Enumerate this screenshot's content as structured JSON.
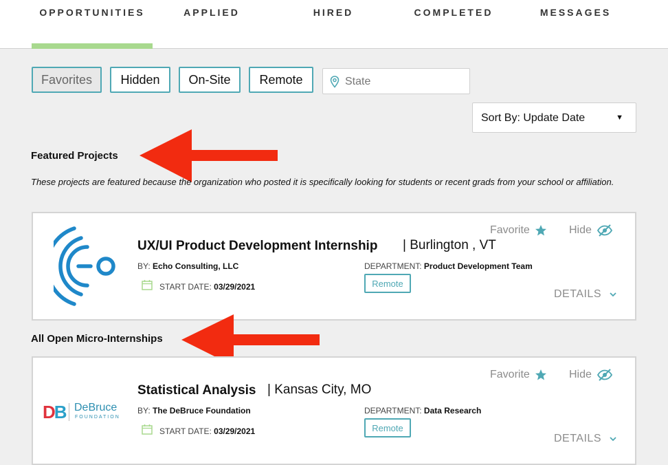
{
  "nav": {
    "tabs": [
      {
        "label": "OPPORTUNITIES",
        "active": true
      },
      {
        "label": "APPLIED"
      },
      {
        "label": "HIRED"
      },
      {
        "label": "COMPLETED"
      },
      {
        "label": "MESSAGES"
      }
    ]
  },
  "filters": {
    "favorites": "Favorites",
    "hidden": "Hidden",
    "onsite": "On-Site",
    "remote": "Remote",
    "state_placeholder": "State",
    "sort": "Sort By: Update Date"
  },
  "featured": {
    "title": "Featured Projects",
    "note": "These projects are featured because the organization who posted it is specifically looking for students or recent grads from your school or affiliation."
  },
  "all_open": {
    "title": "All Open Micro-Internships"
  },
  "cards": [
    {
      "title": "UX/UI Product Development Internship",
      "location": "| Burlington , VT",
      "by_label": "BY:",
      "org": "Echo Consulting, LLC",
      "dept_label": "DEPARTMENT:",
      "dept": "Product Development Team",
      "start_label": "START DATE:",
      "start": "03/29/2021",
      "tag": "Remote",
      "favorite": "Favorite",
      "hide": "Hide",
      "details": "DETAILS"
    },
    {
      "title": "Statistical Analysis",
      "location": "| Kansas City, MO",
      "by_label": "BY:",
      "org": "The DeBruce Foundation",
      "dept_label": "DEPARTMENT:",
      "dept": "Data Research",
      "start_label": "START DATE:",
      "start": "03/29/2021",
      "tag": "Remote",
      "favorite": "Favorite",
      "hide": "Hide",
      "details": "DETAILS",
      "logo_letters": "DB",
      "logo_name": "DeBruce",
      "logo_sub": "FOUNDATION"
    }
  ],
  "colors": {
    "accent_teal": "#4fa8b4",
    "active_tab_underline": "#a8d98e",
    "arrow_red": "#f22b10",
    "page_bg": "#efefef"
  }
}
